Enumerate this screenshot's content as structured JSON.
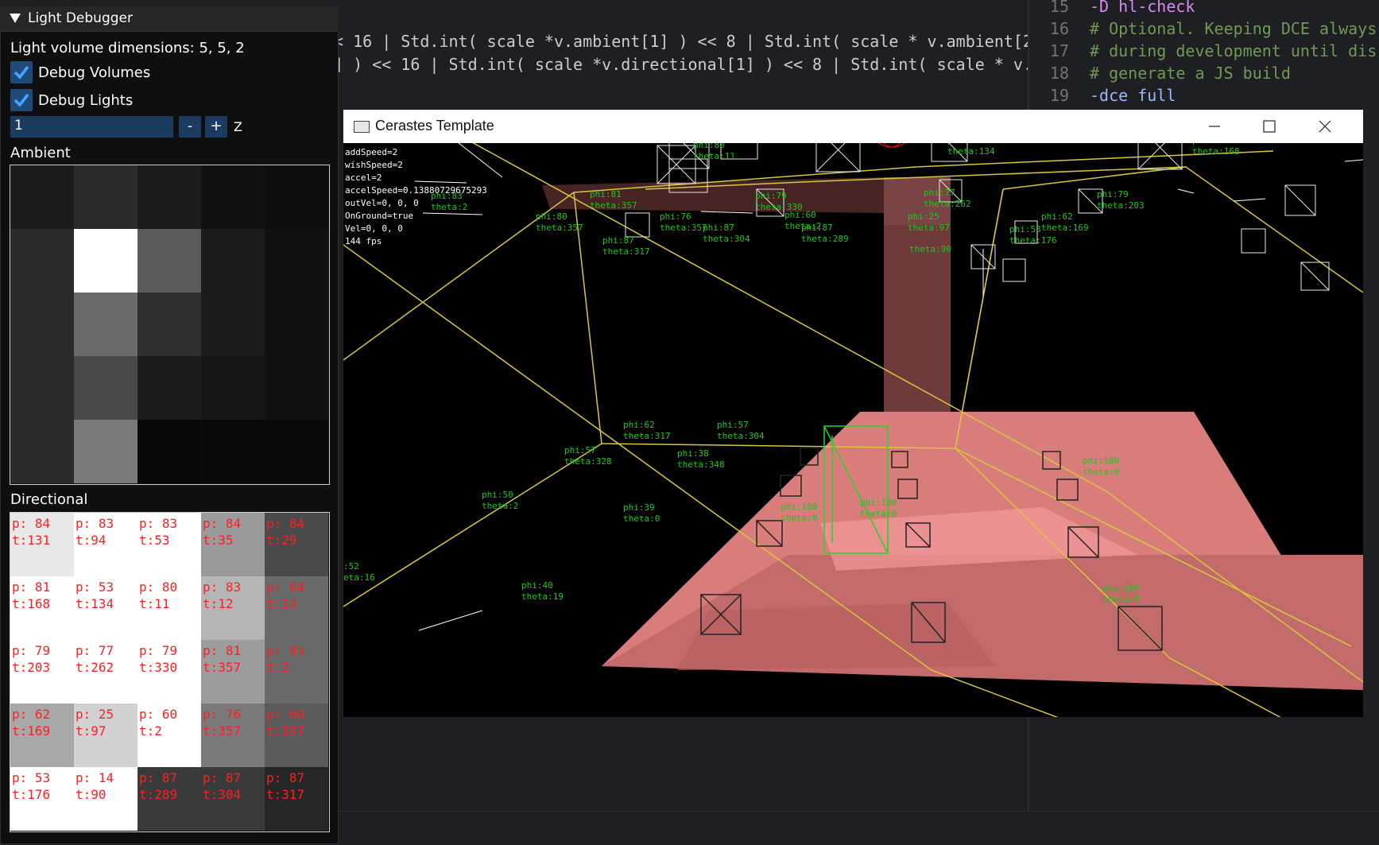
{
  "editor_left": {
    "lines": [
      "< 16 | Std.int( scale *v.ambient[1] ) << 8 | Std.int( scale * v.ambient[2]",
      "] ) << 16 | Std.int( scale *v.directional[1] ) << 8 | Std.int( scale * v.di"
    ]
  },
  "editor_right": {
    "lines": [
      {
        "num": "15",
        "text": "-D hl-check",
        "color": "#d68bf2"
      },
      {
        "num": "16",
        "text": "# Optional. Keeping DCE always",
        "color": "#6f9955"
      },
      {
        "num": "17",
        "text": "# during development until dis",
        "color": "#6f9955"
      },
      {
        "num": "18",
        "text": "# generate a JS build",
        "color": "#6f9955"
      },
      {
        "num": "19",
        "text": "-dce full",
        "color": "#9ab9f5"
      }
    ]
  },
  "debugger": {
    "title": "Light Debugger",
    "dimensions_label": "Light volume dimensions: 5, 5, 2",
    "debug_volumes_label": "Debug Volumes",
    "debug_volumes_checked": true,
    "debug_lights_label": "Debug Lights",
    "debug_lights_checked": true,
    "z_value": "1",
    "minus_label": "-",
    "plus_label": "+",
    "z_label": "Z",
    "ambient_title": "Ambient",
    "ambient_grid": [
      [
        "#1c1c1c",
        "#2b2b2b",
        "#1c1c1c",
        "#111111",
        "#0d0d0d"
      ],
      [
        "#2b2b2b",
        "#ffffff",
        "#5a5a5a",
        "#1c1c1c",
        "#111111"
      ],
      [
        "#2b2b2b",
        "#6b6b6b",
        "#2f2f2f",
        "#1c1c1c",
        "#111111"
      ],
      [
        "#2b2b2b",
        "#484848",
        "#1c1c1c",
        "#161616",
        "#111111"
      ],
      [
        "#2b2b2b",
        "#7a7a7a",
        "#080808",
        "#0b0b0b",
        "#0b0b0b"
      ]
    ],
    "directional_title": "Directional",
    "directional_grid": [
      [
        {
          "p": "p: 84",
          "t": "t:131",
          "bg": "#e8e8e8"
        },
        {
          "p": "p: 83",
          "t": "t:94",
          "bg": "#ffffff"
        },
        {
          "p": "p: 83",
          "t": "t:53",
          "bg": "#ffffff"
        },
        {
          "p": "p: 84",
          "t": "t:35",
          "bg": "#9a9a9a"
        },
        {
          "p": "p: 84",
          "t": "t:29",
          "bg": "#4a4a4a"
        }
      ],
      [
        {
          "p": "p: 81",
          "t": "t:168",
          "bg": "#ffffff"
        },
        {
          "p": "p: 53",
          "t": "t:134",
          "bg": "#ffffff"
        },
        {
          "p": "p: 80",
          "t": "t:11",
          "bg": "#ffffff"
        },
        {
          "p": "p: 83",
          "t": "t:12",
          "bg": "#b5b5b5"
        },
        {
          "p": "p: 84",
          "t": "t:14",
          "bg": "#6a6a6a"
        }
      ],
      [
        {
          "p": "p: 79",
          "t": "t:203",
          "bg": "#ffffff"
        },
        {
          "p": "p: 77",
          "t": "t:262",
          "bg": "#ffffff"
        },
        {
          "p": "p: 79",
          "t": "t:330",
          "bg": "#ffffff"
        },
        {
          "p": "p: 81",
          "t": "t:357",
          "bg": "#9c9c9c"
        },
        {
          "p": "p: 83",
          "t": "t:2",
          "bg": "#6a6a6a"
        }
      ],
      [
        {
          "p": "p: 62",
          "t": "t:169",
          "bg": "#a8a8a8"
        },
        {
          "p": "p: 25",
          "t": "t:97",
          "bg": "#d2d2d2"
        },
        {
          "p": "p: 60",
          "t": "t:2",
          "bg": "#ffffff"
        },
        {
          "p": "p: 76",
          "t": "t:357",
          "bg": "#7a7a7a"
        },
        {
          "p": "p: 60",
          "t": "t:357",
          "bg": "#5a5a5a"
        }
      ],
      [
        {
          "p": "p: 53",
          "t": "t:176",
          "bg": "#ffffff"
        },
        {
          "p": "p: 14",
          "t": "t:90",
          "bg": "#ffffff"
        },
        {
          "p": "p: 87",
          "t": "t:289",
          "bg": "#3a3a3a"
        },
        {
          "p": "p: 87",
          "t": "t:304",
          "bg": "#3a3a3a"
        },
        {
          "p": "p: 87",
          "t": "t:317",
          "bg": "#262626"
        }
      ]
    ],
    "accent": "#4aa3ff"
  },
  "game_window": {
    "title": "Cerastes Template",
    "hud": [
      "addSpeed=2",
      "wishSpeed=2",
      "accel=2",
      "accelSpeed=0.13880729675293",
      "outVel=0, 0, 0",
      "OnGround=true",
      "Vel=0, 0, 0",
      "144 fps"
    ],
    "lights": [
      {
        "phi": "phi:80",
        "theta": "theta:12"
      },
      {
        "phi": "phi:83",
        "theta": "theta:2"
      },
      {
        "phi": "phi:80",
        "theta": "theta:11"
      },
      {
        "phi": "phi:81",
        "theta": "theta:357"
      },
      {
        "phi": "phi:80",
        "theta": "theta:357"
      },
      {
        "phi": "phi:87",
        "theta": "theta:317"
      },
      {
        "phi": "phi:76",
        "theta": "theta:357"
      },
      {
        "phi": "phi:87",
        "theta": "theta:304"
      },
      {
        "phi": "phi:79",
        "theta": "theta:330"
      },
      {
        "phi": "phi:60",
        "theta": "theta:2"
      },
      {
        "phi": "phi:87",
        "theta": "theta:289"
      },
      {
        "phi": "phi:60",
        "theta": "theta:134"
      },
      {
        "phi": "phi:77",
        "theta": "theta:262"
      },
      {
        "phi": "phi:25",
        "theta": "theta:97"
      },
      {
        "phi": "",
        "theta": "theta:90"
      },
      {
        "phi": "phi:81",
        "theta": "theta:168"
      },
      {
        "phi": "phi:79",
        "theta": "theta:203"
      },
      {
        "phi": "phi:62",
        "theta": "theta:169"
      },
      {
        "phi": "phi:53",
        "theta": "theta:176"
      },
      {
        "phi": "phi:62",
        "theta": "theta:317"
      },
      {
        "phi": "phi:57",
        "theta": "theta:304"
      },
      {
        "phi": "phi:57",
        "theta": "theta:328"
      },
      {
        "phi": "phi:38",
        "theta": "theta:348"
      },
      {
        "phi": "phi:50",
        "theta": "theta:2"
      },
      {
        "phi": "phi:39",
        "theta": "theta:0"
      },
      {
        "phi": "phi:40",
        "theta": "theta:19"
      },
      {
        "phi": ":52",
        "theta": "eta:16"
      },
      {
        "phi": "phi:180",
        "theta": "theta:0"
      },
      {
        "phi": "phi:180",
        "theta": "theta:0"
      },
      {
        "phi": "phi:180",
        "theta": "theta:0"
      },
      {
        "phi": "phi:180",
        "theta": "theta:0"
      }
    ]
  }
}
